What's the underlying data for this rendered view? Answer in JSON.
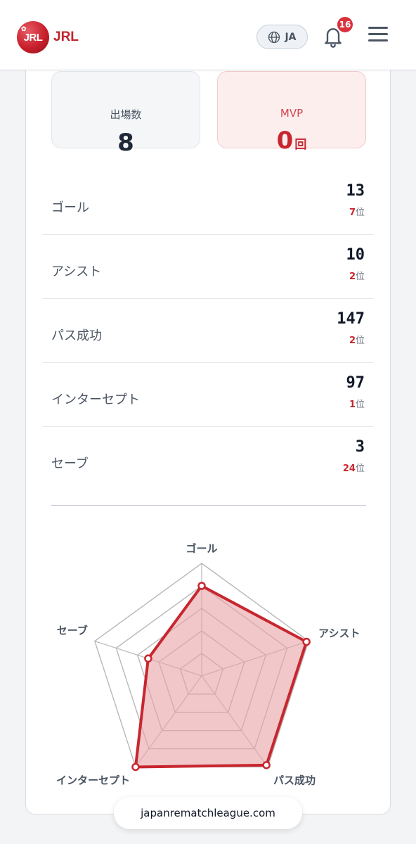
{
  "header": {
    "logo_mark": "JRL",
    "logo_text": "JRL",
    "language": "JA",
    "notification_count": "16"
  },
  "summary": {
    "appearances_label": "出場数",
    "appearances_value": "8",
    "mvp_label": "MVP",
    "mvp_value": "0",
    "mvp_unit": "回"
  },
  "stats": [
    {
      "label": "ゴール",
      "value": "13",
      "rank": "7",
      "rank_suffix": "位"
    },
    {
      "label": "アシスト",
      "value": "10",
      "rank": "2",
      "rank_suffix": "位"
    },
    {
      "label": "パス成功",
      "value": "147",
      "rank": "2",
      "rank_suffix": "位"
    },
    {
      "label": "インターセプト",
      "value": "97",
      "rank": "1",
      "rank_suffix": "位"
    },
    {
      "label": "セーブ",
      "value": "3",
      "rank": "24",
      "rank_suffix": "位"
    }
  ],
  "chart_data": {
    "type": "radar",
    "axes": [
      "ゴール",
      "アシスト",
      "パス成功",
      "インターセプト",
      "セーブ"
    ],
    "values": [
      0.8,
      0.98,
      0.98,
      1.0,
      0.5
    ],
    "range": [
      0,
      1
    ],
    "rings": 5,
    "colors": {
      "line": "#c8262f",
      "fill": "#e7a1a5",
      "grid": "#b8b8b8"
    }
  },
  "footer": {
    "url": "japanrematchleague.com"
  },
  "colors": {
    "accent": "#c8262f",
    "badge": "#d8323c"
  }
}
